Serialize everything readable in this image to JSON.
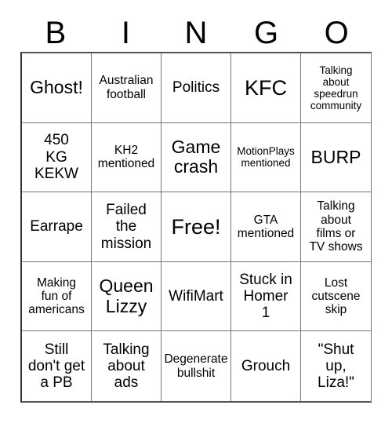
{
  "header": {
    "letters": [
      "B",
      "I",
      "N",
      "G",
      "O"
    ]
  },
  "grid": {
    "columns": 5,
    "rows": 5,
    "cells": [
      {
        "text": "Ghost!",
        "size": "lg"
      },
      {
        "text": "Australian\nfootball",
        "size": "sm"
      },
      {
        "text": "Politics",
        "size": "md"
      },
      {
        "text": "KFC",
        "size": "xl"
      },
      {
        "text": "Talking\nabout\nspeedrun\ncommunity",
        "size": "xs"
      },
      {
        "text": "450\nKG\nKEKW",
        "size": "md"
      },
      {
        "text": "KH2\nmentioned",
        "size": "sm"
      },
      {
        "text": "Game\ncrash",
        "size": "lg"
      },
      {
        "text": "MotionPlays\nmentioned",
        "size": "xs"
      },
      {
        "text": "BURP",
        "size": "lg"
      },
      {
        "text": "Earrape",
        "size": "md"
      },
      {
        "text": "Failed\nthe\nmission",
        "size": "md"
      },
      {
        "text": "Free!",
        "size": "xl"
      },
      {
        "text": "GTA\nmentioned",
        "size": "sm"
      },
      {
        "text": "Talking\nabout\nfilms or\nTV shows",
        "size": "sm"
      },
      {
        "text": "Making\nfun of\namericans",
        "size": "sm"
      },
      {
        "text": "Queen\nLizzy",
        "size": "lg"
      },
      {
        "text": "WifiMart",
        "size": "md"
      },
      {
        "text": "Stuck in\nHomer\n1",
        "size": "md"
      },
      {
        "text": "Lost\ncutscene\nskip",
        "size": "sm"
      },
      {
        "text": "Still\ndon't get\na PB",
        "size": "md"
      },
      {
        "text": "Talking\nabout\nads",
        "size": "md"
      },
      {
        "text": "Degenerate\nbullshit",
        "size": "sm"
      },
      {
        "text": "Grouch",
        "size": "md"
      },
      {
        "text": "\"Shut\nup,\nLiza!\"",
        "size": "md"
      }
    ]
  },
  "colors": {
    "background": "#ffffff",
    "text": "#000000",
    "grid_line": "#777777",
    "grid_border": "#333333"
  }
}
